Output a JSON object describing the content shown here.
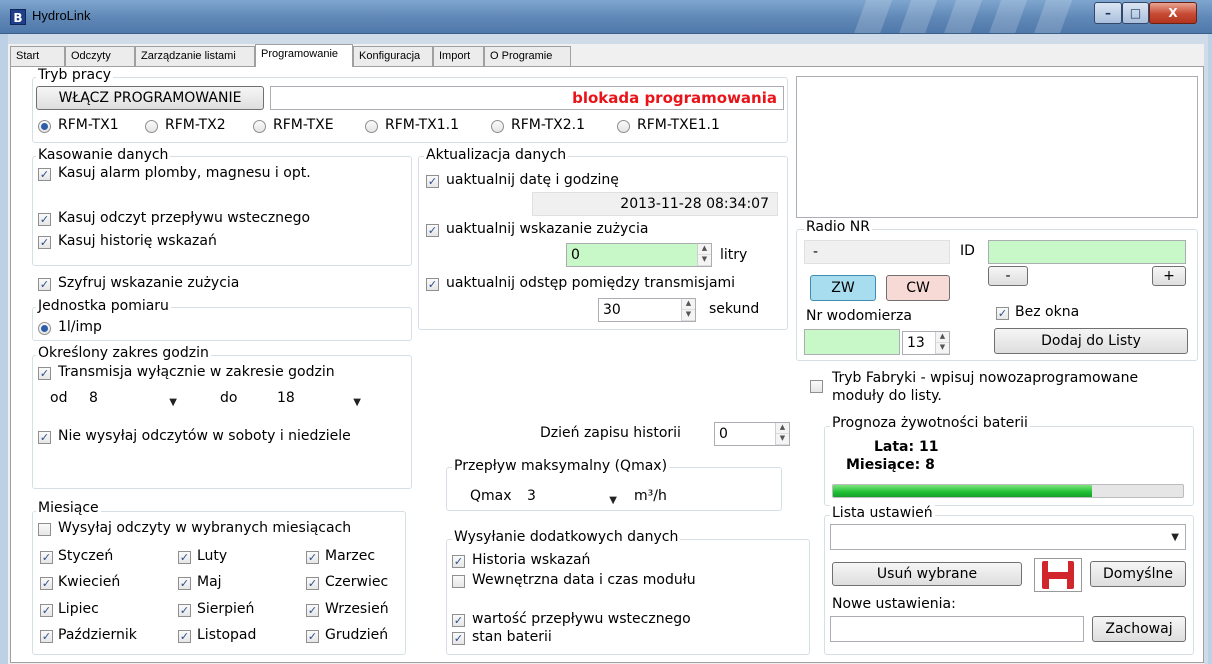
{
  "window": {
    "title": "HydroLink",
    "icon_letter": "B",
    "minimize": "–",
    "maximize": "□",
    "close": "X"
  },
  "tabs": [
    "Start",
    "Odczyty",
    "Zarządzanie listami",
    "Programowanie",
    "Konfiguracja",
    "Import",
    "O Programie"
  ],
  "tryb_pracy": {
    "label": "Tryb pracy",
    "button": "WŁĄCZ PROGRAMOWANIE",
    "status": "blokada programowania",
    "status_color": "#e8141a",
    "modules": [
      "RFM-TX1",
      "RFM-TX2",
      "RFM-TXE",
      "RFM-TX1.1",
      "RFM-TX2.1",
      "RFM-TXE1.1"
    ],
    "selected_module": "RFM-TX1"
  },
  "kasowanie": {
    "label": "Kasowanie danych",
    "alarm": "Kasuj alarm plomby, magnesu i opt.",
    "odczyt": "Kasuj odczyt przepływu wstecznego",
    "historia": "Kasuj historię wskazań"
  },
  "szyfruj": "Szyfruj wskazanie zużycia",
  "jednostka": {
    "label": "Jednostka pomiaru",
    "value": "1l/imp"
  },
  "zakres": {
    "label": "Określony zakres godzin",
    "transmisja": "Transmisja wyłącznie w zakresie godzin",
    "od_label": "od",
    "od_value": "8",
    "do_label": "do",
    "do_value": "18",
    "weekend": "Nie wysyłaj odczytów w soboty i niedziele"
  },
  "aktualizacja": {
    "label": "Aktualizacja danych",
    "date_check": "uaktualnij datę i godzinę",
    "date_value": "2013-11-28 08:34:07",
    "usage_check": "uaktualnij wskazanie zużycia",
    "usage_value": "0",
    "usage_unit": "litry",
    "interval_check": "uaktualnij odstęp pomiędzy transmisjami",
    "interval_value": "30",
    "interval_unit": "sekund"
  },
  "dzien": {
    "label": "Dzień zapisu historii",
    "value": "0"
  },
  "qmax": {
    "label": "Przepływ maksymalny (Qmax)",
    "field_label": "Qmax",
    "value": "3",
    "unit": "m³/h"
  },
  "miesiace": {
    "label": "Miesiące",
    "wybrane": "Wysyłaj odczyty w wybranych miesiącach",
    "months": [
      "Styczeń",
      "Luty",
      "Marzec",
      "Kwiecień",
      "Maj",
      "Czerwiec",
      "Lipiec",
      "Sierpień",
      "Wrzesień",
      "Październik",
      "Listopad",
      "Grudzień"
    ]
  },
  "dodatkowe": {
    "label": "Wysyłanie dodatkowych danych",
    "historia": "Historia wskazań",
    "wewnetrzna": "Wewnętrzna data i czas modułu",
    "przeplyw": "wartość przepływu wstecznego",
    "bateria": "stan baterii"
  },
  "radio": {
    "label": "Radio NR",
    "value": "-",
    "id_label": "ID",
    "minus": "-",
    "plus": "+",
    "zw": "ZW",
    "cw": "CW",
    "bez_okna": "Bez okna",
    "nr_label": "Nr wodomierza",
    "nr_spin": "13",
    "dodaj": "Dodaj do Listy"
  },
  "tryb_fabryki": "Tryb Fabryki - wpisuj nowozaprogramowane moduły do listy.",
  "prognoza": {
    "label": "Prognoza żywotności baterii",
    "lata": "Lata: 11",
    "miesiace": "Miesiące: 8",
    "fill": 0.74
  },
  "lista": {
    "label": "Lista ustawień",
    "usun": "Usuń wybrane",
    "domyslne": "Domyślne",
    "nowe_label": "Nowe ustawienia:",
    "zachowaj": "Zachowaj",
    "save_icon": "floppy-disk-icon",
    "save_color": "#d1262b"
  },
  "colors": {
    "accent_green_field": "#c8f7c8",
    "zw_button": "#a8dcef",
    "cw_button": "#f7d9d6",
    "progress": "#1fbf33"
  }
}
